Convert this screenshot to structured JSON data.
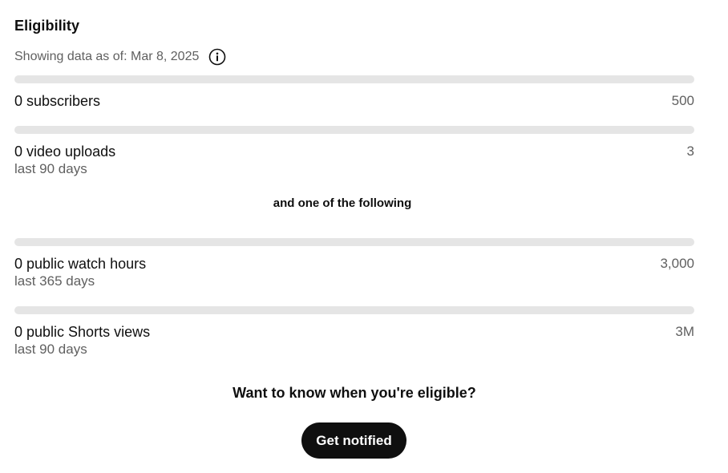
{
  "eligibility": {
    "title": "Eligibility",
    "as_of_text": "Showing data as of: Mar 8, 2025",
    "info_icon": "info-circle-icon"
  },
  "metrics": [
    {
      "label": "0 subscribers",
      "target": "500",
      "sublabel": "",
      "progress": 0
    },
    {
      "label": "0 video uploads",
      "target": "3",
      "sublabel": "last 90 days",
      "progress": 0
    },
    {
      "label": "0 public watch hours",
      "target": "3,000",
      "sublabel": "last 365 days",
      "progress": 0
    },
    {
      "label": "0 public Shorts views",
      "target": "3M",
      "sublabel": "last 90 days",
      "progress": 0
    }
  ],
  "separator_text": "and one of the following",
  "cta": {
    "question": "Want to know when you're eligible?",
    "button_label": "Get notified"
  },
  "colors": {
    "track": "#e5e5e5",
    "fill": "#0f0f0f",
    "primary_text": "#0f0f0f",
    "secondary_text": "#606060",
    "button_bg": "#0f0f0f",
    "button_text": "#ffffff"
  }
}
